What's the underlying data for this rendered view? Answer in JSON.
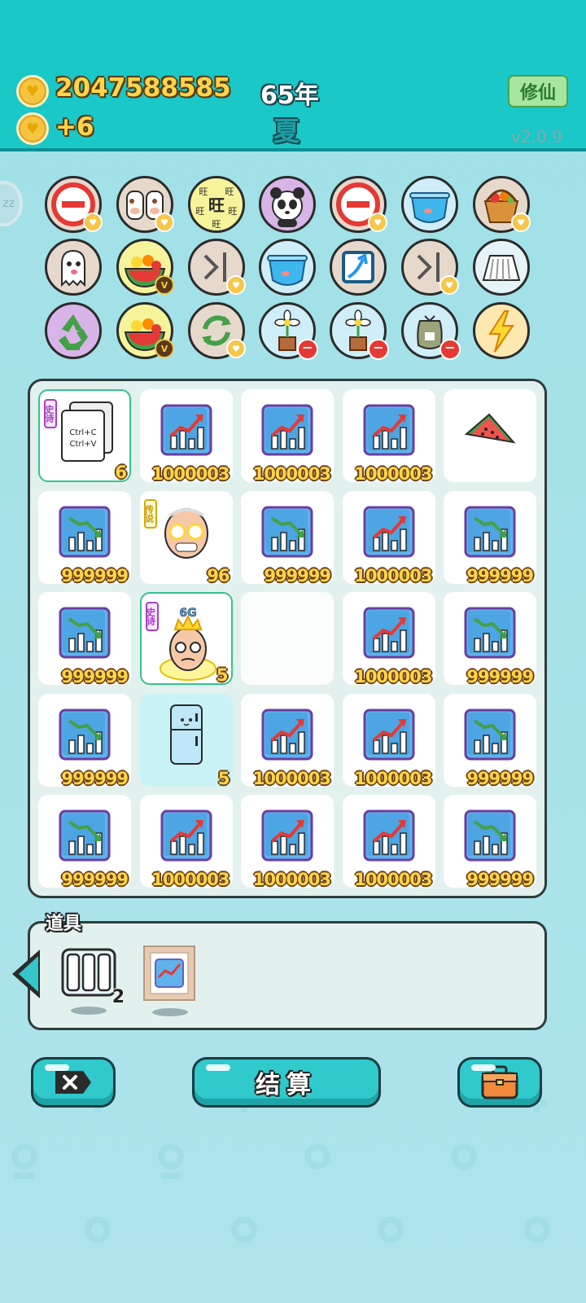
{
  "header": {
    "coins": "2047588585",
    "income": "+6",
    "year": "65年",
    "season": "夏",
    "xiuxian_label": "修仙",
    "version": "v2.0.9"
  },
  "side_handle_label": "zz",
  "icon_rows": [
    [
      "no-entry-icon",
      "twin-cows-icon",
      "wang-text-icon",
      "panda-icon",
      "no-entry-icon",
      "fishbowl-icon",
      "fruit-basket-icon"
    ],
    [
      "ghost-icon",
      "fruit-bowl-icon",
      "skip-icon",
      "fishbowl-icon",
      "arrow-card-icon",
      "skip-icon",
      "pleated-skirt-icon"
    ],
    [
      "recycle-icon",
      "fruit-bowl-icon",
      "refresh-icon",
      "potted-flower-icon",
      "potted-flower-icon",
      "trash-bag-icon",
      "lightning-icon"
    ]
  ],
  "wang_char": "旺",
  "board": {
    "cells": [
      {
        "type": "copy",
        "label1": "Ctrl+C",
        "label2": "Ctrl+V",
        "tag": "史诗",
        "count": "6",
        "selected": true
      },
      {
        "type": "up",
        "count": "1000003"
      },
      {
        "type": "up",
        "count": "1000003"
      },
      {
        "type": "up",
        "count": "1000003"
      },
      {
        "type": "watermelon",
        "count": ""
      },
      {
        "type": "down",
        "count": "999999"
      },
      {
        "type": "oldman",
        "tag": "传说",
        "count": "96"
      },
      {
        "type": "down",
        "count": "999999"
      },
      {
        "type": "up",
        "count": "1000003"
      },
      {
        "type": "down",
        "count": "999999"
      },
      {
        "type": "down",
        "count": "999999"
      },
      {
        "type": "king",
        "tag": "史诗",
        "crown_text": "6G",
        "count": "5",
        "selected": true
      },
      {
        "type": "empty",
        "count": ""
      },
      {
        "type": "up",
        "count": "1000003"
      },
      {
        "type": "down",
        "count": "999999"
      },
      {
        "type": "down",
        "count": "999999"
      },
      {
        "type": "fridge",
        "count": "5",
        "cyan": true
      },
      {
        "type": "up",
        "count": "1000003"
      },
      {
        "type": "up",
        "count": "1000003"
      },
      {
        "type": "down",
        "count": "999999"
      },
      {
        "type": "down",
        "count": "999999"
      },
      {
        "type": "up",
        "count": "1000003"
      },
      {
        "type": "up",
        "count": "1000003"
      },
      {
        "type": "up",
        "count": "1000003"
      },
      {
        "type": "down",
        "count": "999999"
      }
    ]
  },
  "tools": {
    "title": "道具",
    "items": [
      {
        "name": "triple-slot-item",
        "count": "2"
      },
      {
        "name": "framed-chart-item",
        "count": ""
      }
    ]
  },
  "buttons": {
    "settle_label": "结算"
  },
  "colors": {
    "header_bg": "#1ac8c8",
    "gold_text": "#ffd54a",
    "button_bg": "#30c9cc"
  }
}
